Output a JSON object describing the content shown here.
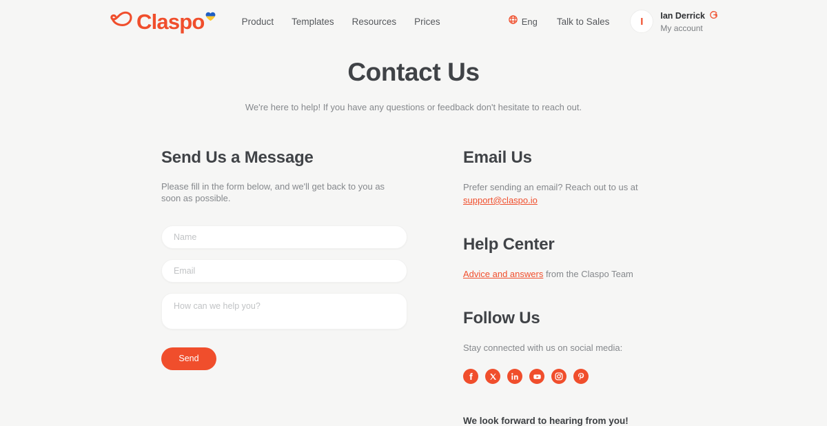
{
  "header": {
    "logo": {
      "name": "claspo-logo",
      "word": "Claspo",
      "mark_icon": "cloud-outline-icon",
      "heart_icon": "ukraine-heart-icon",
      "brand_color": "#f04e2c"
    },
    "nav": [
      {
        "label": "Product",
        "name": "nav-item-product"
      },
      {
        "label": "Templates",
        "name": "nav-item-templates"
      },
      {
        "label": "Resources",
        "name": "nav-item-resources"
      },
      {
        "label": "Prices",
        "name": "nav-item-prices"
      }
    ],
    "language": {
      "icon": "globe-icon",
      "label": "Eng"
    },
    "talk_to_sales": "Talk to Sales",
    "account": {
      "avatar_initial": "I",
      "name": "Ian Derrick",
      "subtitle": "My account",
      "logout_icon": "logout-circle-arrow-icon"
    }
  },
  "hero": {
    "title": "Contact Us",
    "subtitle": "We're here to help! If you have any questions or feedback don't hesitate to reach out."
  },
  "form_section": {
    "title": "Send Us a Message",
    "description": "Please fill in the form below, and we'll get back to you as soon as possible.",
    "fields": {
      "name": {
        "placeholder": "Name",
        "value": ""
      },
      "email": {
        "placeholder": "Email",
        "value": ""
      },
      "message": {
        "placeholder": "How can we help you?",
        "value": ""
      }
    },
    "submit_label": "Send",
    "submit_color": "#f04e2c"
  },
  "email_section": {
    "title": "Email Us",
    "text_before": "Prefer sending an email? Reach out to us at",
    "email_link": "support@claspo.io"
  },
  "help_section": {
    "title": "Help Center",
    "link_text": "Advice and answers",
    "text_after": " from the Claspo Team"
  },
  "follow_section": {
    "title": "Follow Us",
    "text": "Stay connected with us on social media:",
    "socials": [
      {
        "name": "facebook-icon",
        "label": "Facebook"
      },
      {
        "name": "x-twitter-icon",
        "label": "X"
      },
      {
        "name": "linkedin-icon",
        "label": "LinkedIn"
      },
      {
        "name": "youtube-icon",
        "label": "YouTube"
      },
      {
        "name": "instagram-icon",
        "label": "Instagram"
      },
      {
        "name": "pinterest-icon",
        "label": "Pinterest"
      }
    ],
    "icon_color": "#f04e2c"
  },
  "closing_text": "We look forward to hearing from you!",
  "page": {
    "background": "#f6f6f5"
  }
}
